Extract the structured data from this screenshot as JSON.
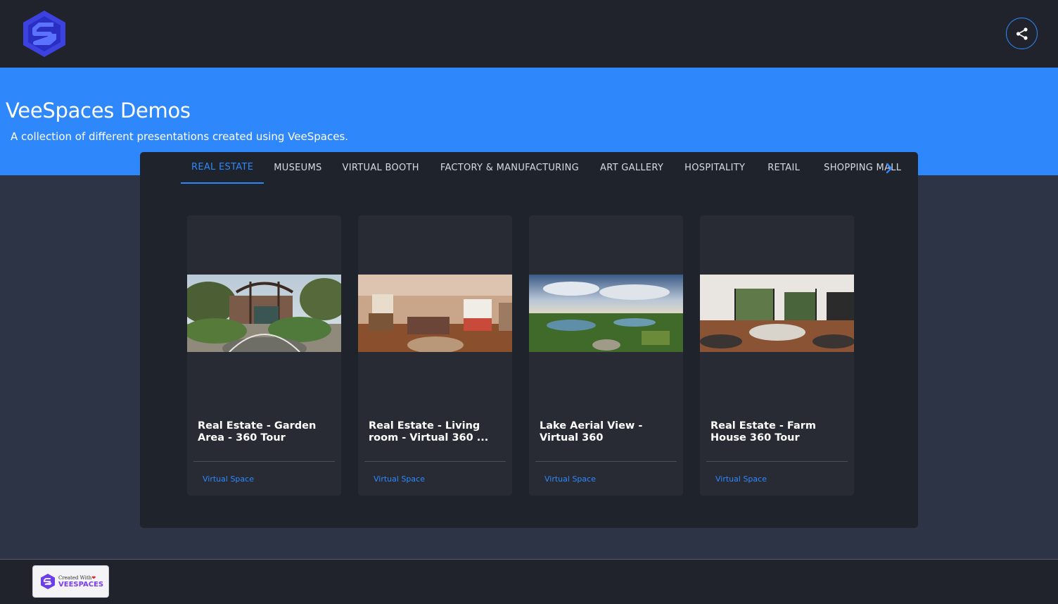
{
  "header": {
    "logo_icon": "veespaces-logo-icon",
    "share_icon": "share-icon"
  },
  "hero": {
    "title": "VeeSpaces Demos",
    "subtitle": "A collection of different presentations created using VeeSpaces."
  },
  "tabs": [
    {
      "label": "REAL ESTATE",
      "active": true
    },
    {
      "label": "MUSEUMS"
    },
    {
      "label": "VIRTUAL BOOTH"
    },
    {
      "label": "FACTORY & MANUFACTURING"
    },
    {
      "label": "ART GALLERY"
    },
    {
      "label": "HOSPITALITY"
    },
    {
      "label": "RETAIL"
    },
    {
      "label": "SHOPPING MALL"
    }
  ],
  "cards": [
    {
      "title": "Real Estate - Garden Area - 360 Tour",
      "tag": "Virtual Space"
    },
    {
      "title": "Real Estate - Living room - Virtual 360 ...",
      "tag": "Virtual Space"
    },
    {
      "title": "Lake Aerial View - Virtual 360",
      "tag": "Virtual Space"
    },
    {
      "title": "Real Estate - Farm House 360 Tour",
      "tag": "Virtual Space"
    }
  ],
  "footer": {
    "badge_line1": "Created With",
    "badge_line2": "VEESPACES"
  },
  "colors": {
    "accent": "#2f88fb",
    "topbar": "#20232b",
    "panel": "#1f232c",
    "card": "#282b33",
    "page_bg": "#2d3446"
  }
}
